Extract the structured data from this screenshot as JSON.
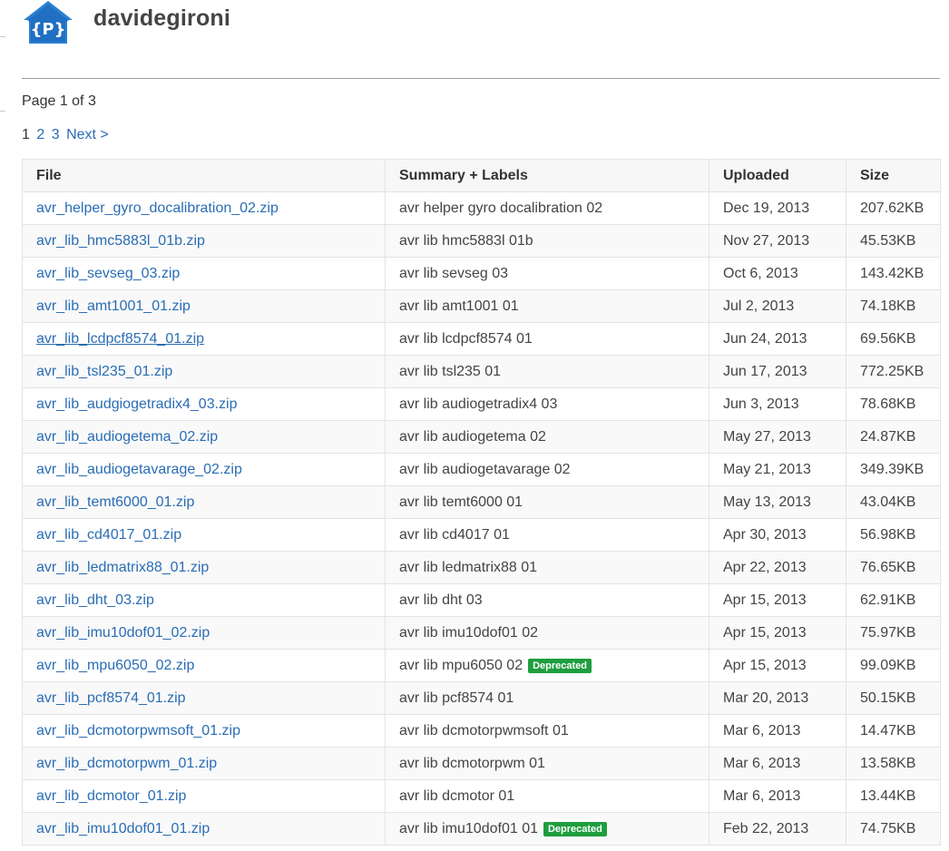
{
  "project": {
    "name": "davidegironi",
    "logo_letter": "{P}"
  },
  "pagination": {
    "page_info": "Page 1 of 3",
    "current": "1",
    "pages": [
      "2",
      "3"
    ],
    "next_label": "Next >"
  },
  "table": {
    "columns": [
      "File",
      "Summary + Labels",
      "Uploaded",
      "Size"
    ],
    "rows": [
      {
        "file": "avr_helper_gyro_docalibration_02.zip",
        "summary": "avr helper gyro docalibration 02",
        "badge": "",
        "uploaded": "Dec 19, 2013",
        "size": "207.62KB"
      },
      {
        "file": "avr_lib_hmc5883l_01b.zip",
        "summary": "avr lib hmc5883l 01b",
        "badge": "",
        "uploaded": "Nov 27, 2013",
        "size": "45.53KB"
      },
      {
        "file": "avr_lib_sevseg_03.zip",
        "summary": "avr lib sevseg 03",
        "badge": "",
        "uploaded": "Oct 6, 2013",
        "size": "143.42KB"
      },
      {
        "file": "avr_lib_amt1001_01.zip",
        "summary": "avr lib amt1001 01",
        "badge": "",
        "uploaded": "Jul 2, 2013",
        "size": "74.18KB"
      },
      {
        "file": "avr_lib_lcdpcf8574_01.zip",
        "summary": "avr lib lcdpcf8574 01",
        "badge": "",
        "uploaded": "Jun 24, 2013",
        "size": "69.56KB",
        "hovered": true
      },
      {
        "file": "avr_lib_tsl235_01.zip",
        "summary": "avr lib tsl235 01",
        "badge": "",
        "uploaded": "Jun 17, 2013",
        "size": "772.25KB"
      },
      {
        "file": "avr_lib_audgiogetradix4_03.zip",
        "summary": "avr lib audiogetradix4 03",
        "badge": "",
        "uploaded": "Jun 3, 2013",
        "size": "78.68KB"
      },
      {
        "file": "avr_lib_audiogetema_02.zip",
        "summary": "avr lib audiogetema 02",
        "badge": "",
        "uploaded": "May 27, 2013",
        "size": "24.87KB"
      },
      {
        "file": "avr_lib_audiogetavarage_02.zip",
        "summary": "avr lib audiogetavarage 02",
        "badge": "",
        "uploaded": "May 21, 2013",
        "size": "349.39KB"
      },
      {
        "file": "avr_lib_temt6000_01.zip",
        "summary": "avr lib temt6000 01",
        "badge": "",
        "uploaded": "May 13, 2013",
        "size": "43.04KB"
      },
      {
        "file": "avr_lib_cd4017_01.zip",
        "summary": "avr lib cd4017 01",
        "badge": "",
        "uploaded": "Apr 30, 2013",
        "size": "56.98KB"
      },
      {
        "file": "avr_lib_ledmatrix88_01.zip",
        "summary": "avr lib ledmatrix88 01",
        "badge": "",
        "uploaded": "Apr 22, 2013",
        "size": "76.65KB"
      },
      {
        "file": "avr_lib_dht_03.zip",
        "summary": "avr lib dht 03",
        "badge": "",
        "uploaded": "Apr 15, 2013",
        "size": "62.91KB"
      },
      {
        "file": "avr_lib_imu10dof01_02.zip",
        "summary": "avr lib imu10dof01 02",
        "badge": "",
        "uploaded": "Apr 15, 2013",
        "size": "75.97KB"
      },
      {
        "file": "avr_lib_mpu6050_02.zip",
        "summary": "avr lib mpu6050 02",
        "badge": "Deprecated",
        "uploaded": "Apr 15, 2013",
        "size": "99.09KB"
      },
      {
        "file": "avr_lib_pcf8574_01.zip",
        "summary": "avr lib pcf8574 01",
        "badge": "",
        "uploaded": "Mar 20, 2013",
        "size": "50.15KB"
      },
      {
        "file": "avr_lib_dcmotorpwmsoft_01.zip",
        "summary": "avr lib dcmotorpwmsoft 01",
        "badge": "",
        "uploaded": "Mar 6, 2013",
        "size": "14.47KB"
      },
      {
        "file": "avr_lib_dcmotorpwm_01.zip",
        "summary": "avr lib dcmotorpwm 01",
        "badge": "",
        "uploaded": "Mar 6, 2013",
        "size": "13.58KB"
      },
      {
        "file": "avr_lib_dcmotor_01.zip",
        "summary": "avr lib dcmotor 01",
        "badge": "",
        "uploaded": "Mar 6, 2013",
        "size": "13.44KB"
      },
      {
        "file": "avr_lib_imu10dof01_01.zip",
        "summary": "avr lib imu10dof01 01",
        "badge": "Deprecated",
        "uploaded": "Feb 22, 2013",
        "size": "74.75KB"
      }
    ]
  },
  "colors": {
    "link": "#2a6db4",
    "badge": "#1e9e3e",
    "logo": "#2b7fd3"
  }
}
